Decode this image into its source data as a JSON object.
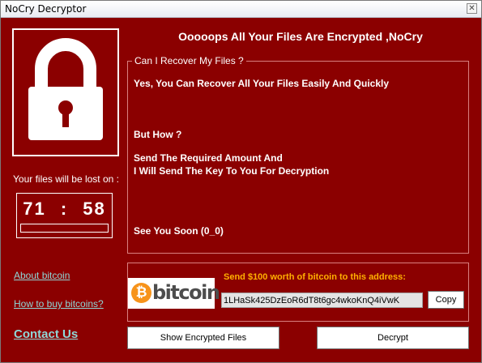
{
  "window": {
    "title": "NoCry Decryptor",
    "close_glyph": "✕"
  },
  "heading": "Ooooops All Your Files Are Encrypted ,NoCry",
  "countdown": {
    "label": "Your files will be lost on :",
    "hours": "71",
    "separator": ":",
    "minutes": "58"
  },
  "info": {
    "legend": "Can I Recover My Files ?",
    "line1": "Yes, You Can Recover All Your Files Easily And Quickly",
    "line2": "But How ?",
    "line3": "Send The Required Amount And",
    "line4": "I Will Send The Key To You For Decryption",
    "line5": "See You Soon (0_0)"
  },
  "payment": {
    "logo_symbol": "₿",
    "logo_text": "bitcoin",
    "send_label": "Send $100 worth of bitcoin to this address:",
    "address": "1LHaSk425DzEoR6dT8t6gc4wkoKnQ4iVwK",
    "copy_label": "Copy"
  },
  "links": {
    "about": "About bitcoin",
    "how_to_buy": "How to buy bitcoins?",
    "contact": "Contact Us"
  },
  "buttons": {
    "show_files": "Show Encrypted Files",
    "decrypt": "Decrypt"
  },
  "colors": {
    "background": "#8b0000",
    "accent_text": "#ffb000",
    "link": "#8fd7d7",
    "bitcoin_orange": "#f7931a"
  },
  "icons": {
    "lock": "padlock-icon",
    "close": "close-icon"
  }
}
